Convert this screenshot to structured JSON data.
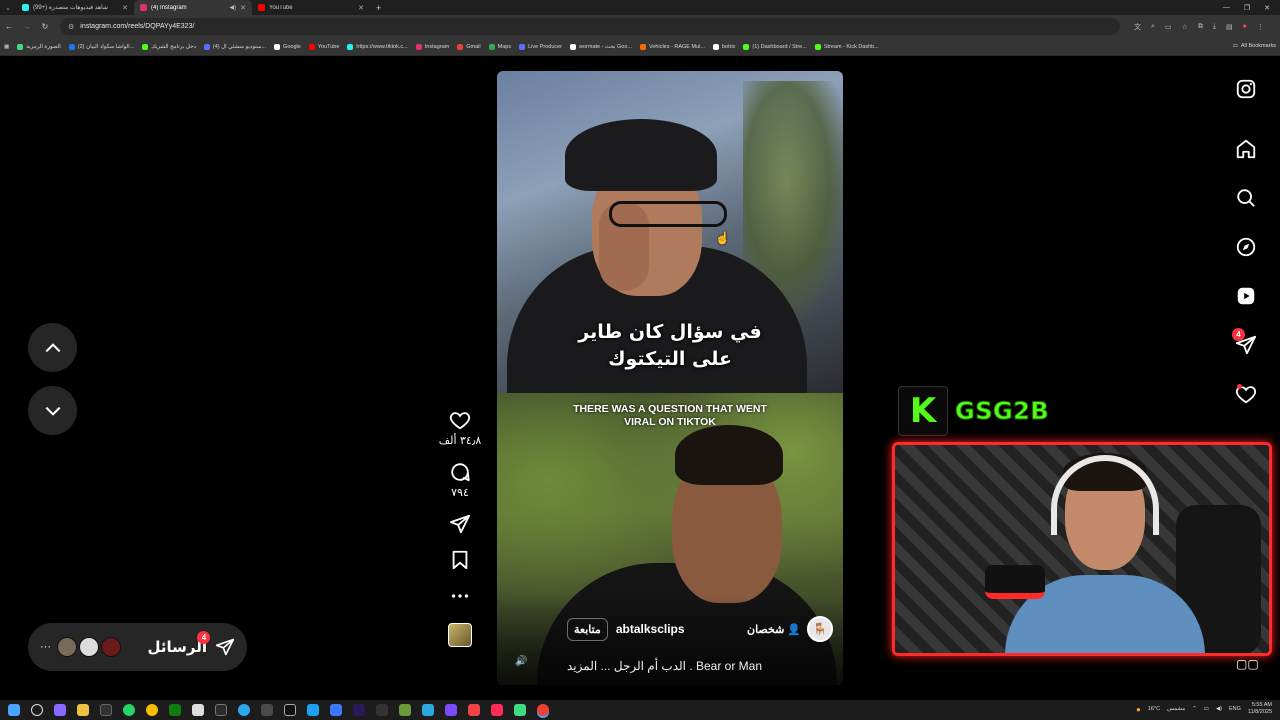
{
  "browser": {
    "tabs": [
      {
        "title": "(99+) شاهد فيديوهات متصدرة",
        "favicon_color": "#25f4ee",
        "active": false
      },
      {
        "title": "(4) Instagram",
        "favicon_color": "#e1306c",
        "active": true
      },
      {
        "title": "YouTube",
        "favicon_color": "#ff0000",
        "active": false
      }
    ],
    "url": "instagram.com/reels/DQPAYy4E323/",
    "bookmarks": [
      {
        "label": "الصورة الرمزية",
        "color": "#3ddc84"
      },
      {
        "label": "(2) الواشا سكواد البيان...",
        "color": "#1877f2"
      },
      {
        "label": "دخل برنامج الشريك",
        "color": "#53fc18"
      },
      {
        "label": "(4) ستوديو منشئي ال...",
        "color": "#5b6cff"
      },
      {
        "label": "Google",
        "color": "#ffffff"
      },
      {
        "label": "YouTube",
        "color": "#ff0000"
      },
      {
        "label": "https://www.tiktok.c...",
        "color": "#25f4ee"
      },
      {
        "label": "Instagram",
        "color": "#e1306c"
      },
      {
        "label": "Gmail",
        "color": "#ea4335"
      },
      {
        "label": "Maps",
        "color": "#34a853"
      },
      {
        "label": "Live Producer",
        "color": "#5b6cff"
      },
      {
        "label": "wormate - بحث Goo...",
        "color": "#ffffff"
      },
      {
        "label": "Vehicles - RAGE Mul...",
        "color": "#ff6a00"
      },
      {
        "label": "botrix",
        "color": "#ffffff"
      },
      {
        "label": "(1) Dashboard / Stre...",
        "color": "#53fc18"
      },
      {
        "label": "Stream - Kick Dashb...",
        "color": "#53fc18"
      }
    ],
    "all_bookmarks": "All Bookmarks"
  },
  "reel": {
    "caption_ar_line1": "في سؤال كان طاير",
    "caption_ar_line2": "على التيكتوك",
    "caption_en_line1": "THERE WAS A QUESTION THAT WENT",
    "caption_en_line2": "VIRAL ON TIKTOK",
    "username": "abtalksclips",
    "follow_label": "متابعة",
    "people_label": "شخصان",
    "description": "Bear or Man . الدب أم الرجل ... المزيد",
    "likes": "٣٤٫٨ ألف",
    "comments": "٧٩٤"
  },
  "messages": {
    "label": "الرسائل",
    "badge": "4"
  },
  "sidebar": {
    "messages_badge": "4"
  },
  "overlay": {
    "channel_name": "GSG2B",
    "brand_color": "#53fc18",
    "cam_border_color": "#ff2a2a"
  },
  "taskbar": {
    "weather": "16°C",
    "weather_label": "مشمس",
    "lang": "ENG",
    "time": "5:55 AM",
    "date": "11/8/2025"
  }
}
